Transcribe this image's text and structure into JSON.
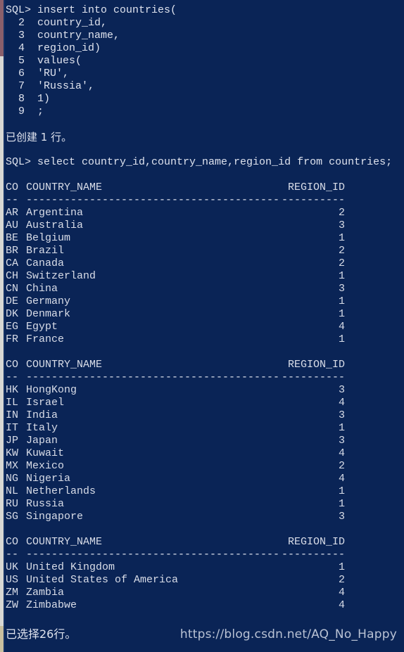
{
  "window": {
    "background_color": "#0a2456",
    "text_color": "#dfe3ee",
    "edge_maroon_color": "#8a5f6b",
    "edge_grey_color": "#d8d8d4",
    "edge_tan_color": "#c9bf9f"
  },
  "session": {
    "prompt": "SQL>",
    "insert_statement": {
      "lines": [
        "SQL> insert into countries(",
        "  2  country_id,",
        "  3  country_name,",
        "  4  region_id)",
        "  5  values(",
        "  6  'RU',",
        "  7  'Russia',",
        "  8  1)",
        "  9  ;"
      ]
    },
    "insert_result": "已创建 1 行。",
    "select_statement": "SQL> select country_id,country_name,region_id from countries;",
    "select_result": "已选择26行。"
  },
  "table": {
    "headers": {
      "code": "CO",
      "name": "COUNTRY_NAME",
      "region": "REGION_ID"
    },
    "separators": {
      "code": "--",
      "name": "----------------------------------------",
      "region": "----------"
    },
    "blocks": [
      {
        "rows": [
          {
            "code": "AR",
            "name": "Argentina",
            "region": "2"
          },
          {
            "code": "AU",
            "name": "Australia",
            "region": "3"
          },
          {
            "code": "BE",
            "name": "Belgium",
            "region": "1"
          },
          {
            "code": "BR",
            "name": "Brazil",
            "region": "2"
          },
          {
            "code": "CA",
            "name": "Canada",
            "region": "2"
          },
          {
            "code": "CH",
            "name": "Switzerland",
            "region": "1"
          },
          {
            "code": "CN",
            "name": "China",
            "region": "3"
          },
          {
            "code": "DE",
            "name": "Germany",
            "region": "1"
          },
          {
            "code": "DK",
            "name": "Denmark",
            "region": "1"
          },
          {
            "code": "EG",
            "name": "Egypt",
            "region": "4"
          },
          {
            "code": "FR",
            "name": "France",
            "region": "1"
          }
        ]
      },
      {
        "rows": [
          {
            "code": "HK",
            "name": "HongKong",
            "region": "3"
          },
          {
            "code": "IL",
            "name": "Israel",
            "region": "4"
          },
          {
            "code": "IN",
            "name": "India",
            "region": "3"
          },
          {
            "code": "IT",
            "name": "Italy",
            "region": "1"
          },
          {
            "code": "JP",
            "name": "Japan",
            "region": "3"
          },
          {
            "code": "KW",
            "name": "Kuwait",
            "region": "4"
          },
          {
            "code": "MX",
            "name": "Mexico",
            "region": "2"
          },
          {
            "code": "NG",
            "name": "Nigeria",
            "region": "4"
          },
          {
            "code": "NL",
            "name": "Netherlands",
            "region": "1"
          },
          {
            "code": "RU",
            "name": "Russia",
            "region": "1"
          },
          {
            "code": "SG",
            "name": "Singapore",
            "region": "3"
          }
        ]
      },
      {
        "rows": [
          {
            "code": "UK",
            "name": "United Kingdom",
            "region": "1"
          },
          {
            "code": "US",
            "name": "United States of America",
            "region": "2"
          },
          {
            "code": "ZM",
            "name": "Zambia",
            "region": "4"
          },
          {
            "code": "ZW",
            "name": "Zimbabwe",
            "region": "4"
          }
        ]
      }
    ]
  },
  "watermark": {
    "text": "https://blog.csdn.net/AQ_No_Happy"
  }
}
